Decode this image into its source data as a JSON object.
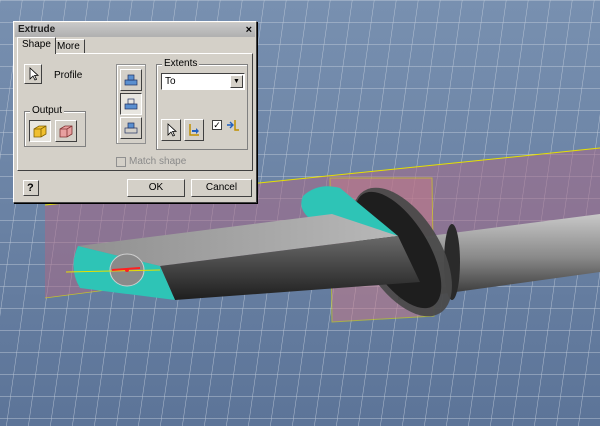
{
  "window": {
    "title": "Extrude",
    "close_glyph": "×"
  },
  "tabs": [
    {
      "label": "Shape",
      "active": true
    },
    {
      "label": "More",
      "active": false
    }
  ],
  "profile": {
    "label": "Profile",
    "icon": "cursor-select-icon"
  },
  "output": {
    "label": "Output",
    "buttons": [
      "solid-icon",
      "surface-icon"
    ]
  },
  "operations": [
    "join-icon",
    "cut-icon",
    "intersect-icon"
  ],
  "extents": {
    "label": "Extents",
    "selected": "To",
    "checkbox_checked": true
  },
  "match_shape": {
    "label": "Match shape",
    "checked": false,
    "enabled": false
  },
  "buttons": {
    "help_glyph": "?",
    "ok": "OK",
    "cancel": "Cancel"
  },
  "colors": {
    "dialog_bg": "#d4d0c8",
    "viewport_bg": "#6f86a8",
    "grid": "#c9d3e0",
    "plane": "#a86a86",
    "accent_teal": "#2ec4b6",
    "sketch_yellow": "#e6e000",
    "sketch_red": "#ff2020"
  }
}
